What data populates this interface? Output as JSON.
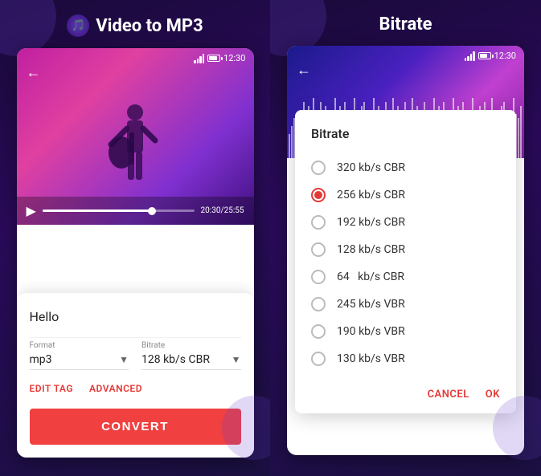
{
  "left": {
    "title": "Video to MP3",
    "status_time": "12:30",
    "filename": "Hello",
    "format_label": "Format",
    "format_value": "mp3",
    "bitrate_label": "Bitrate",
    "bitrate_value": "128 kb/s CBR",
    "edit_tag_label": "EDIT TAG",
    "advanced_label": "ADVANCED",
    "convert_label": "CONVERT",
    "time_current": "20:30",
    "time_total": "25:55"
  },
  "right": {
    "title": "Bitrate",
    "status_time": "12:30",
    "dialog_title": "Bitrate",
    "options": [
      {
        "label": "320 kb/s CBR",
        "selected": false
      },
      {
        "label": "256 kb/s CBR",
        "selected": true
      },
      {
        "label": "192 kb/s CBR",
        "selected": false
      },
      {
        "label": "128 kb/s CBR",
        "selected": false
      },
      {
        "label": "64   kb/s CBR",
        "selected": false
      },
      {
        "label": "245 kb/s VBR",
        "selected": false
      },
      {
        "label": "190 kb/s VBR",
        "selected": false
      },
      {
        "label": "130 kb/s VBR",
        "selected": false
      }
    ],
    "cancel_label": "CANCEL",
    "ok_label": "OK"
  }
}
